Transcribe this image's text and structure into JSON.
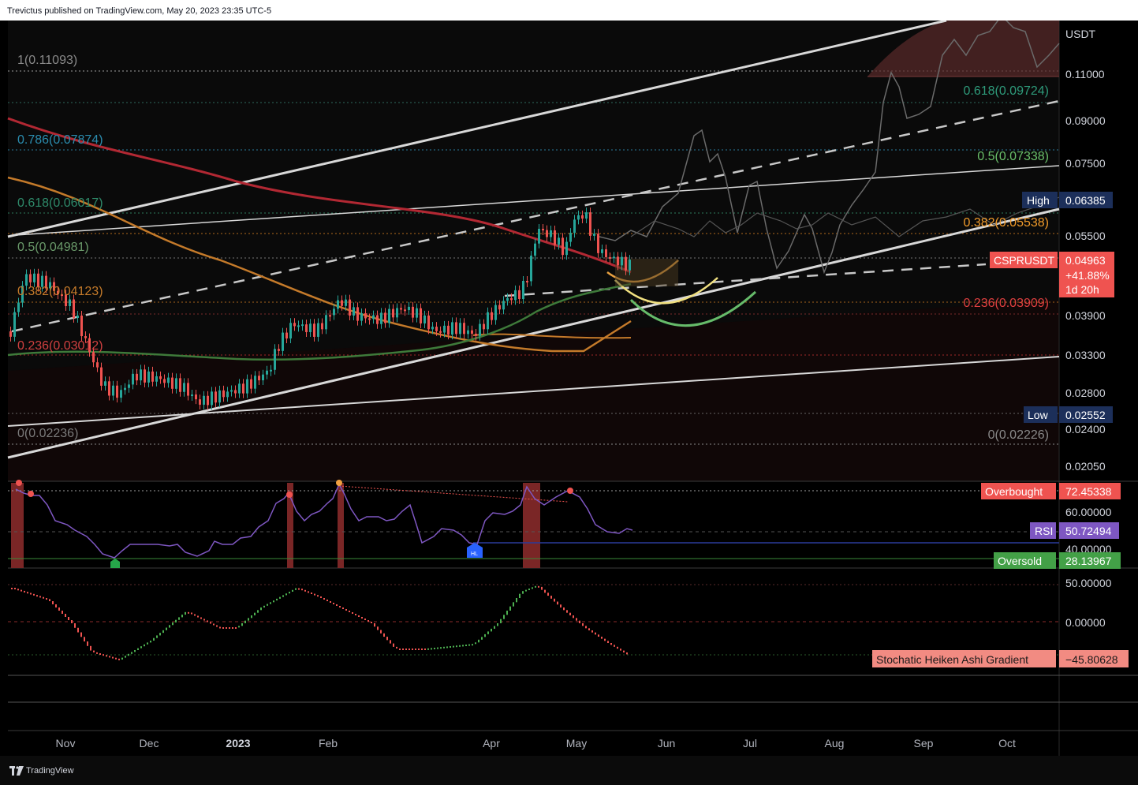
{
  "header": {
    "published_text": "Trevictus published on TradingView.com, May 20, 2023 23:35 UTC-5"
  },
  "footer": {
    "brand": "TradingView"
  },
  "price_axis": {
    "currency": "USDT",
    "ticks": [
      "0.11000",
      "0.09000",
      "0.07500",
      "0.05500",
      "0.03900",
      "0.03300",
      "0.02800",
      "0.02400",
      "0.02050"
    ]
  },
  "price_badges": {
    "high_label": "High",
    "high_value": "0.06385",
    "low_label": "Low",
    "low_value": "0.02552",
    "symbol": "CSPRUSDT",
    "last_price": "0.04963",
    "change": "+41.88%",
    "countdown": "1d 20h"
  },
  "fib_left": [
    "1(0.11093)",
    "0.786(0.07874)",
    "0.618(0.06017)",
    "0.5(0.04981)",
    "0.382(0.04123)",
    "0.236(0.03012)",
    "0(0.02236)"
  ],
  "fib_right": [
    "0.618(0.09724)",
    "0.5(0.07338)",
    "0.382(0.05538)",
    "0.236(0.03909)",
    "0(0.02226)"
  ],
  "rsi_panel": {
    "overbought_label": "Overbought",
    "overbought_value": "72.45338",
    "rsi_label": "RSI",
    "rsi_value": "50.72494",
    "oversold_label": "Oversold",
    "oversold_value": "28.13967",
    "ticks": [
      "60.00000",
      "40.00000"
    ],
    "marker_label": "HL"
  },
  "stoch_panel": {
    "label": "Stochatic Heiken Ashi Gradient",
    "value": "−45.80628",
    "ticks": [
      "50.00000",
      "0.00000"
    ]
  },
  "time_axis": [
    "Nov",
    "Dec",
    "2023",
    "Feb",
    "Apr",
    "May",
    "Jun",
    "Jul",
    "Aug",
    "Sep",
    "Oct"
  ],
  "colors": {
    "up": "#26a69a",
    "down": "#ef5350",
    "ma200": "#b22833",
    "ma100": "#c47a2a",
    "ma50": "#3e7a3a",
    "rsi": "#7e57c2",
    "stoch_up": "#4caf50",
    "stoch_down": "#ef5350"
  }
}
